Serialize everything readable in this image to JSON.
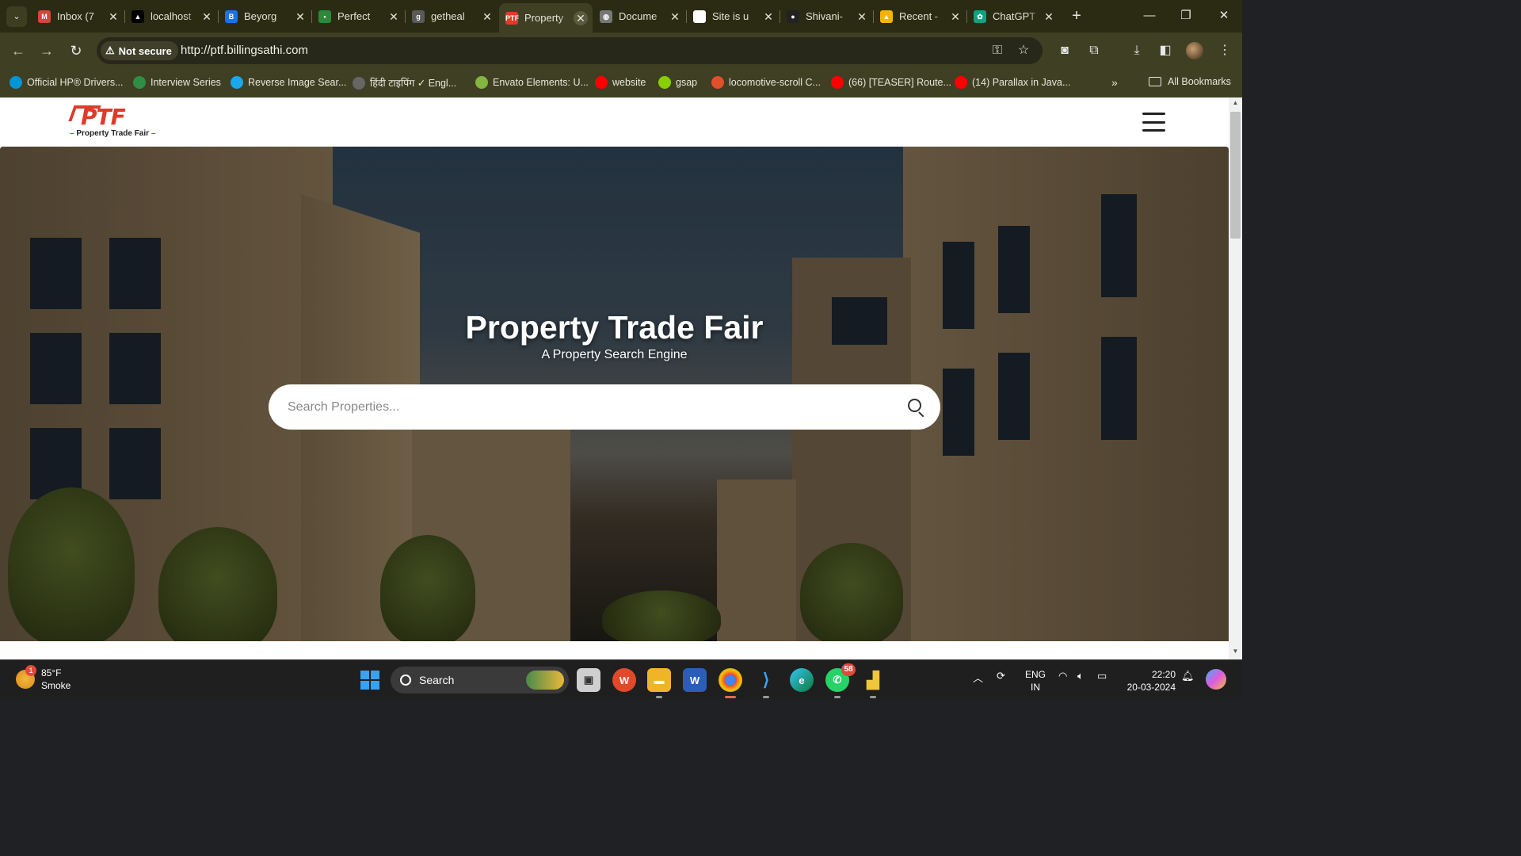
{
  "browser": {
    "tabs": [
      {
        "title": "Inbox (7",
        "favicon": "gmail-icon",
        "color": "#d44638",
        "glyph": "M"
      },
      {
        "title": "localhost",
        "favicon": "vercel-icon",
        "color": "#000000",
        "glyph": "▲"
      },
      {
        "title": "Beyorg",
        "favicon": "beyorg-icon",
        "color": "#1a73e8",
        "glyph": "B"
      },
      {
        "title": "Perfect",
        "favicon": "dots-icon",
        "color": "#2a8a3a",
        "glyph": "•"
      },
      {
        "title": "getheal",
        "favicon": "gethealth-icon",
        "color": "#5a5a5a",
        "glyph": "g"
      },
      {
        "title": "Property",
        "favicon": "ptf-icon",
        "color": "#e03a2a",
        "glyph": "PTF",
        "active": true
      },
      {
        "title": "Docume",
        "favicon": "globe-icon",
        "color": "#777777",
        "glyph": "◍"
      },
      {
        "title": "Site is u",
        "favicon": "site-icon",
        "color": "#ffffff",
        "glyph": "S"
      },
      {
        "title": "Shivani-",
        "favicon": "github-icon",
        "color": "#222222",
        "glyph": "●"
      },
      {
        "title": "Recent -",
        "favicon": "drive-icon",
        "color": "#f4b400",
        "glyph": "▲"
      },
      {
        "title": "ChatGPT",
        "favicon": "chatgpt-icon",
        "color": "#10a37f",
        "glyph": "✿"
      }
    ],
    "new_tab_label": "+",
    "security_chip": "Not secure",
    "url": "http://ptf.billingsathi.com",
    "bookmarks": [
      {
        "label": "Official HP® Drivers...",
        "icon": "hp-icon",
        "color": "#0096d6"
      },
      {
        "label": "Interview Series",
        "icon": "gfg-icon",
        "color": "#2f8d46"
      },
      {
        "label": "Reverse Image Sear...",
        "icon": "reverse-image-icon",
        "color": "#1aa7ec"
      },
      {
        "label": "हिंदी टाइपिंग ✓ Engl...",
        "icon": "typing-icon",
        "color": "#666666"
      },
      {
        "label": "Envato Elements: U...",
        "icon": "envato-icon",
        "color": "#82b541"
      },
      {
        "label": "website",
        "icon": "youtube-icon",
        "color": "#ff0000"
      },
      {
        "label": "gsap",
        "icon": "gsap-icon",
        "color": "#88ce02"
      },
      {
        "label": "locomotive-scroll C...",
        "icon": "locomotive-icon",
        "color": "#e0502a"
      },
      {
        "label": "(66) [TEASER] Route...",
        "icon": "youtube-icon",
        "color": "#ff0000"
      },
      {
        "label": "(14) Parallax in Java...",
        "icon": "youtube-icon",
        "color": "#ff0000"
      }
    ],
    "all_bookmarks": "All Bookmarks"
  },
  "site": {
    "logo_mark": "PTF",
    "logo_sub": "Property Trade Fair",
    "hero": {
      "title": "Property Trade Fair",
      "subtitle": "A Property Search Engine",
      "search_placeholder": "Search Properties..."
    }
  },
  "taskbar": {
    "weather_temp": "85°F",
    "weather_desc": "Smoke",
    "weather_badge": "1",
    "search_label": "Search",
    "whatsapp_badge": "58",
    "lang_top": "ENG",
    "lang_bottom": "IN",
    "time": "22:20",
    "date": "20-03-2024"
  }
}
